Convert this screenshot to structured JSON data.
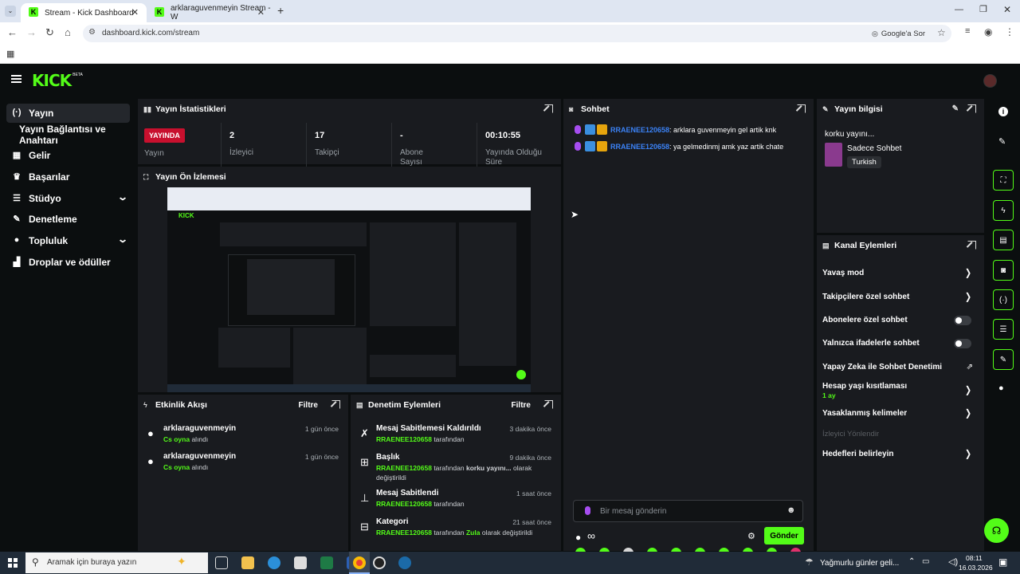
{
  "browser": {
    "tabs": [
      {
        "title": "Stream - Kick Dashboard"
      },
      {
        "title": "arklaraguvenmeyin Stream - W"
      }
    ],
    "url": "dashboard.kick.com/stream",
    "google_lens": "Google'a Sor"
  },
  "app": {
    "logo": "KICK",
    "logo_badge": "BETA"
  },
  "sidebar": {
    "items": [
      {
        "label": "Yayın"
      },
      {
        "label": "Yayın Bağlantısı ve Anahtarı"
      },
      {
        "label": "Gelir"
      },
      {
        "label": "Başarılar"
      },
      {
        "label": "Stüdyo"
      },
      {
        "label": "Denetleme"
      },
      {
        "label": "Topluluk"
      },
      {
        "label": "Droplar ve ödüller"
      }
    ]
  },
  "stats": {
    "title": "Yayın İstatistikleri",
    "status_badge": "YAYINDA",
    "status_label": "Yayın",
    "viewers_value": "2",
    "viewers_label": "İzleyici",
    "followers_value": "17",
    "followers_label": "Takipçi",
    "subs_value": "-",
    "subs_label": "Abone Sayısı",
    "time_value": "00:10:55",
    "time_label": "Yayında Olduğu Süre"
  },
  "preview": {
    "title": "Yayın Ön İzlemesi"
  },
  "activity": {
    "title": "Etkinlik Akışı",
    "filter": "Filtre",
    "items": [
      {
        "user": "arklaraguvenmeyin",
        "action": "Cs oyna",
        "suffix": "alındı",
        "time": "1 gün önce"
      },
      {
        "user": "arklaraguvenmeyin",
        "action": "Cs oyna",
        "suffix": "alındı",
        "time": "1 gün önce"
      }
    ]
  },
  "moderation": {
    "title": "Denetim Eylemleri",
    "filter": "Filtre",
    "items": [
      {
        "title": "Mesaj Sabitlemesi Kaldırıldı",
        "user": "RRAENEE120658",
        "rest": "tarafından",
        "time": "3 dakika önce"
      },
      {
        "title": "Başlık",
        "user": "RRAENEE120658",
        "rest": "tarafından",
        "extra": "korku yayını...",
        "rest2": "olarak",
        "line2": "değiştirildi",
        "time": "9 dakika önce"
      },
      {
        "title": "Mesaj Sabitlendi",
        "user": "RRAENEE120658",
        "rest": "tarafından",
        "time": "1 saat önce"
      },
      {
        "title": "Kategori",
        "user": "RRAENEE120658",
        "rest": "tarafından",
        "extra": "Zula",
        "rest2": "olarak değiştirildi",
        "time": "21 saat önce"
      }
    ]
  },
  "chat": {
    "title": "Sohbet",
    "messages": [
      {
        "user": "RRAENEE120658",
        "text": ": arklara guvenmeyin gel artik knk"
      },
      {
        "user": "RRAENEE120658",
        "text": ": ya gelmedinmj amk yaz artik chate"
      }
    ],
    "input_placeholder": "Bir mesaj gönderin",
    "send_label": "Gönder",
    "infinity": "∞"
  },
  "stream_info": {
    "title": "Yayın bilgisi",
    "stream_title": "korku yayını...",
    "category": "Sadece Sohbet",
    "language": "Turkish"
  },
  "channel_actions": {
    "title": "Kanal Eylemleri",
    "items": [
      {
        "label": "Yavaş mod"
      },
      {
        "label": "Takipçilere özel sohbet"
      },
      {
        "label": "Abonelere özel sohbet"
      },
      {
        "label": "Yalnızca ifadelerle sohbet"
      },
      {
        "label": "Yapay Zeka ile Sohbet Denetimi"
      },
      {
        "label": "Hesap yaşı kısıtlaması",
        "sub": "1 ay"
      },
      {
        "label": "Yasaklanmış kelimeler"
      },
      {
        "label": "İzleyici Yönlendir"
      },
      {
        "label": "Hedefleri belirleyin"
      }
    ]
  },
  "taskbar": {
    "search_placeholder": "Aramak için buraya yazın",
    "weather": "Yağmurlu günler geli...",
    "time": "08:11",
    "date": "16.03.2026"
  }
}
